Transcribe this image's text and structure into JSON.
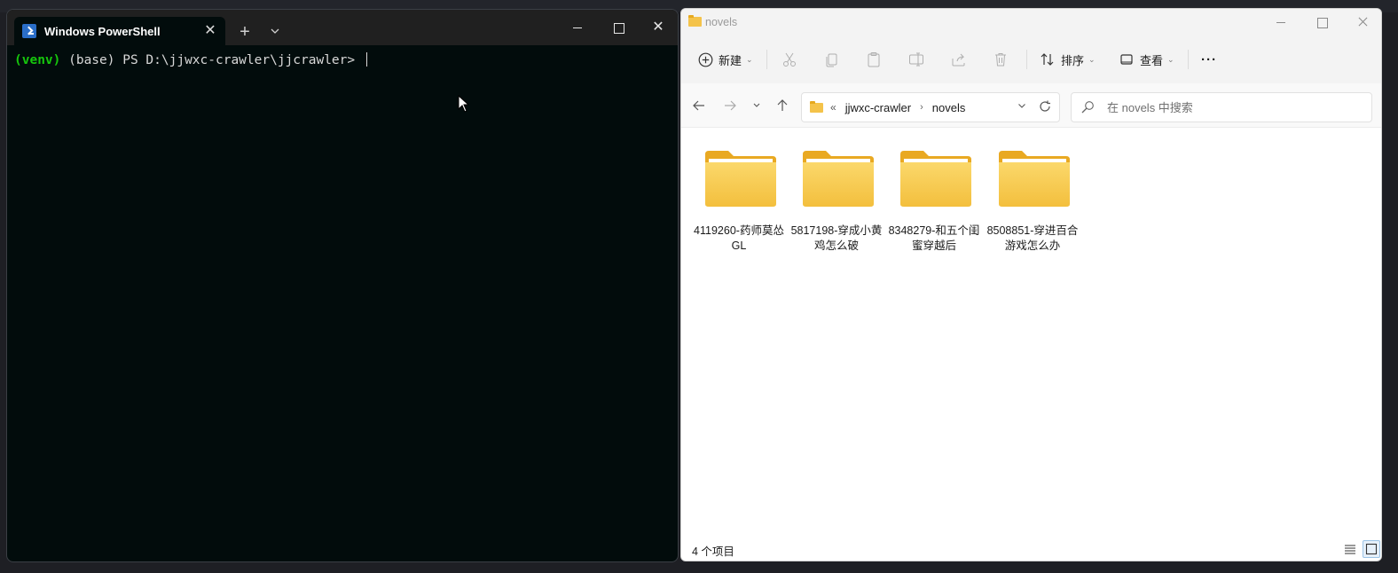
{
  "terminal": {
    "tab_title": "Windows PowerShell",
    "prompt_venv": "(venv)",
    "prompt_rest": " (base) PS D:\\jjwxc-crawler\\jjcrawler> ",
    "tab_close_glyph": "✕",
    "new_tab_glyph": "+",
    "dropdown_glyph": "⌄",
    "close_glyph": "✕"
  },
  "explorer": {
    "window_title": "novels",
    "toolbar": {
      "new_label": "新建",
      "sort_label": "排序",
      "view_label": "查看",
      "more_label": "···"
    },
    "address": {
      "chevrons": "«",
      "segments": [
        "jjwxc-crawler",
        "novels"
      ],
      "arrow": "›"
    },
    "search": {
      "placeholder": "在 novels 中搜索"
    },
    "folders": [
      {
        "name": "4119260-药师莫怂GL"
      },
      {
        "name": "5817198-穿成小黄鸡怎么破"
      },
      {
        "name": "8348279-和五个闺蜜穿越后"
      },
      {
        "name": "8508851-穿进百合游戏怎么办"
      }
    ],
    "status": {
      "item_count": "4 个项目"
    }
  },
  "colors": {
    "terminal_bg": "#020c0c",
    "venv_green": "#16c60c",
    "folder_yellow": "#f4c34a",
    "accent_blue": "#0067c0"
  }
}
